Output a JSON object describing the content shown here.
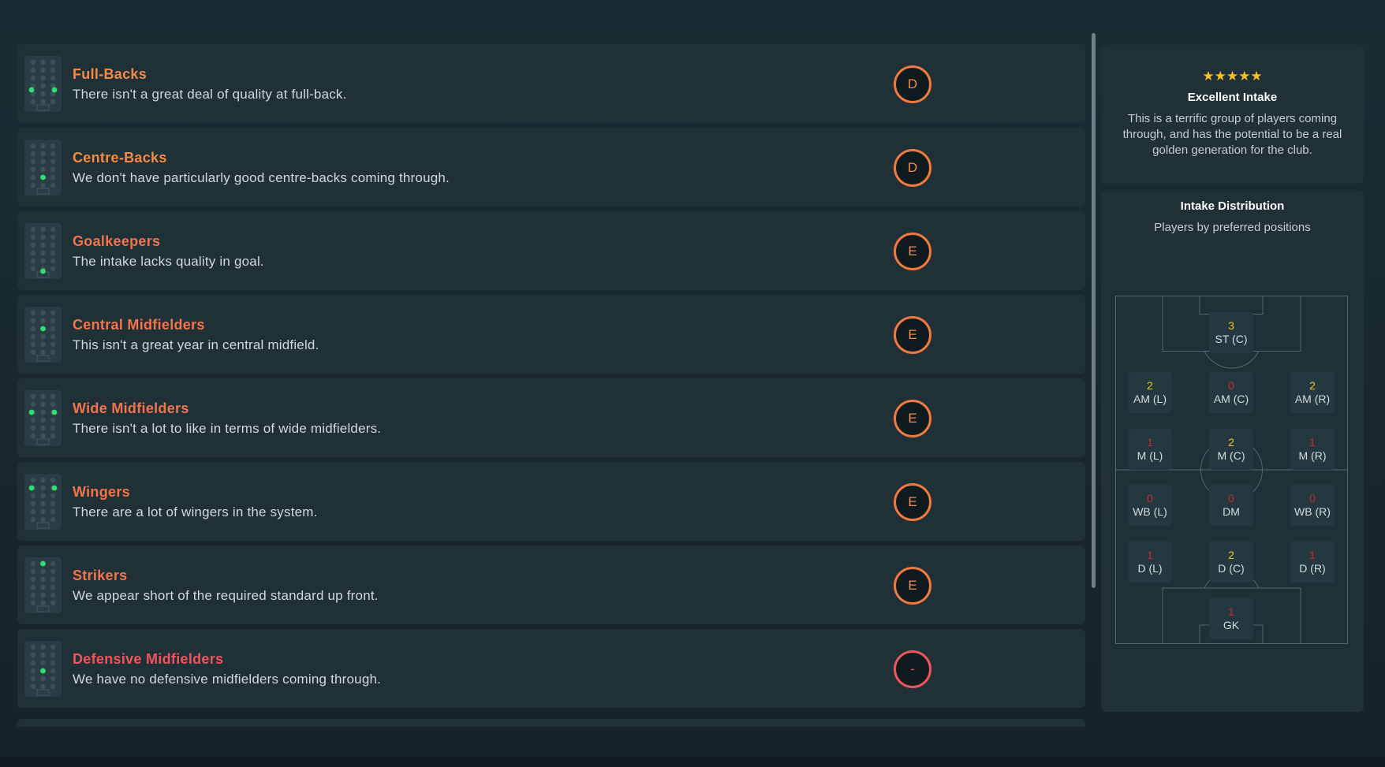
{
  "rows": [
    {
      "title": "Full-Backs",
      "description": "There isn't a great deal of quality at full-back.",
      "grade": "D",
      "title_color": "#f38a45",
      "dots": [
        [
          1,
          3.5
        ],
        [
          3,
          3.5
        ]
      ]
    },
    {
      "title": "Centre-Backs",
      "description": "We don't have particularly good centre-backs coming through.",
      "grade": "D",
      "title_color": "#f38a45",
      "dots": [
        [
          2,
          4
        ]
      ]
    },
    {
      "title": "Goalkeepers",
      "description": "The intake lacks quality in goal.",
      "grade": "E",
      "title_color": "#f2744a",
      "dots": [
        [
          2,
          5.3
        ]
      ]
    },
    {
      "title": "Central Midfielders",
      "description": "This isn't a great year in central midfield.",
      "grade": "E",
      "title_color": "#f2744a",
      "dots": [
        [
          2,
          2
        ]
      ]
    },
    {
      "title": "Wide Midfielders",
      "description": "There isn't a lot to like in terms of wide midfielders.",
      "grade": "E",
      "title_color": "#f2744a",
      "dots": [
        [
          1,
          2
        ],
        [
          3,
          2
        ]
      ]
    },
    {
      "title": "Wingers",
      "description": "There are a lot of wingers in the system.",
      "grade": "E",
      "title_color": "#f2744a",
      "dots": [
        [
          1,
          1
        ],
        [
          3,
          1
        ]
      ]
    },
    {
      "title": "Strikers",
      "description": "We appear short of the required standard up front.",
      "grade": "E",
      "title_color": "#f2744a",
      "dots": [
        [
          2,
          0
        ]
      ]
    },
    {
      "title": "Defensive Midfielders",
      "description": "We have no defensive midfielders coming through.",
      "grade": "-",
      "title_color": "#f0555c",
      "dots": [
        [
          2,
          3
        ]
      ]
    }
  ],
  "intake": {
    "stars": "★★★★★",
    "rating_count": 5,
    "title": "Excellent Intake",
    "description": "This is a terrific group of players coming through, and has the potential to be a real golden generation for the club."
  },
  "distribution": {
    "title": "Intake Distribution",
    "subtitle": "Players by preferred positions",
    "positions": {
      "st_c": {
        "num": "3",
        "label": "ST (C)",
        "color": "yellow"
      },
      "am_l": {
        "num": "2",
        "label": "AM (L)",
        "color": "yellow"
      },
      "am_c": {
        "num": "0",
        "label": "AM (C)",
        "color": "red"
      },
      "am_r": {
        "num": "2",
        "label": "AM (R)",
        "color": "yellow"
      },
      "m_l": {
        "num": "1",
        "label": "M (L)",
        "color": "red"
      },
      "m_c": {
        "num": "2",
        "label": "M (C)",
        "color": "yellow"
      },
      "m_r": {
        "num": "1",
        "label": "M (R)",
        "color": "red"
      },
      "wb_l": {
        "num": "0",
        "label": "WB (L)",
        "color": "red"
      },
      "dm": {
        "num": "0",
        "label": "DM",
        "color": "red"
      },
      "wb_r": {
        "num": "0",
        "label": "WB (R)",
        "color": "red"
      },
      "d_l": {
        "num": "1",
        "label": "D (L)",
        "color": "red"
      },
      "d_c": {
        "num": "2",
        "label": "D (C)",
        "color": "yellow"
      },
      "d_r": {
        "num": "1",
        "label": "D (R)",
        "color": "red"
      },
      "gk": {
        "num": "1",
        "label": "GK",
        "color": "red"
      }
    }
  },
  "colors": {
    "accent_green": "#2fe06f",
    "grade_orange": "#f07a3e",
    "grade_red": "#f0555c",
    "star_yellow": "#f3c220"
  }
}
